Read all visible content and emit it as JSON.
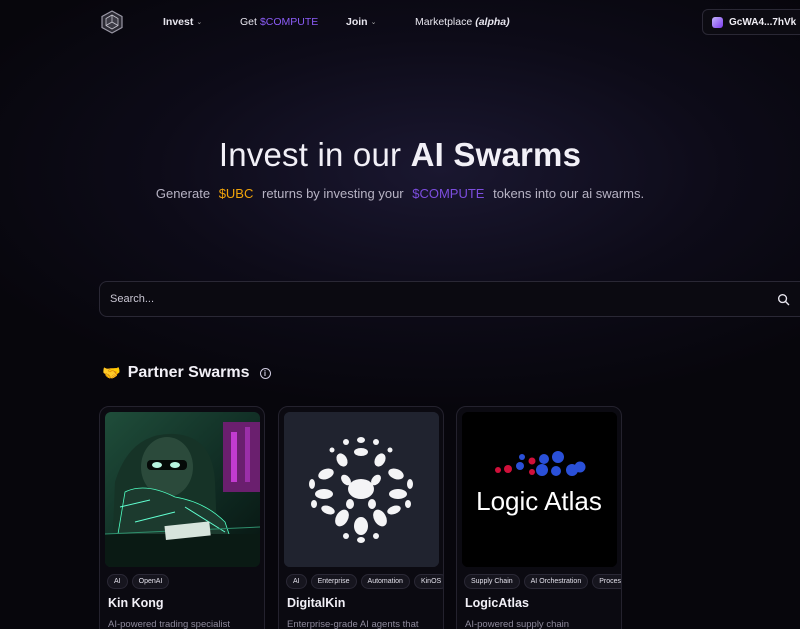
{
  "nav": {
    "items": [
      {
        "label": "Invest",
        "has_dropdown": true
      },
      {
        "label_prefix": "Get ",
        "label_accent": "$COMPUTE"
      },
      {
        "label": "Join",
        "has_dropdown": true
      },
      {
        "label_prefix": "Marketplace ",
        "label_italic": "(alpha)"
      }
    ],
    "wallet": "GcWA4...7hVk"
  },
  "hero": {
    "title_light": "Invest in our ",
    "title_bold": "AI Swarms",
    "sub_1": "Generate",
    "sub_ubc": "$UBC",
    "sub_2": "returns by investing your",
    "sub_compute": "$COMPUTE",
    "sub_3": "tokens into our ai swarms."
  },
  "search": {
    "placeholder": "Search..."
  },
  "section": {
    "emoji": "🤝",
    "title": "Partner Swarms"
  },
  "cards": [
    {
      "name": "Kin Kong",
      "tags": [
        "AI",
        "OpenAI"
      ],
      "desc": "AI-powered trading specialist"
    },
    {
      "name": "DigitalKin",
      "tags": [
        "AI",
        "Enterprise",
        "Automation",
        "KinOS"
      ],
      "desc": "Enterprise-grade AI agents that"
    },
    {
      "name": "LogicAtlas",
      "tags": [
        "Supply Chain",
        "AI Orchestration",
        "Proces"
      ],
      "desc": "AI-powered supply chain",
      "logo_text": "Logic Atlas"
    }
  ],
  "colors": {
    "ubc": "#f0a30a",
    "compute": "#7c4dde",
    "background": "#07060c"
  }
}
